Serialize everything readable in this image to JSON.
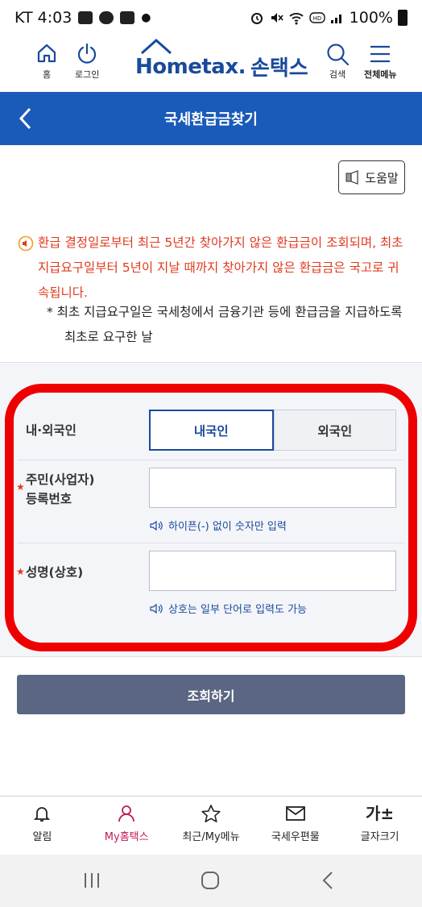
{
  "status_bar": {
    "carrier_time": "KT 4:03",
    "battery": "100%"
  },
  "header": {
    "home_label": "홈",
    "login_label": "로그인",
    "logo_text": "Hometax.",
    "logo_sub": "손택스",
    "search_label": "검색",
    "menu_label": "전체메뉴"
  },
  "titlebar": {
    "title": "국세환급금찾기"
  },
  "help_button": "도움말",
  "notice": "환급 결정일로부터 최근 5년간 찾아가지 않은 환급금이 조회되며, 최초 지급요구일부터 5년이 지날 때까지 찾아가지 않은 환급금은 국고로 귀속됩니다.",
  "note": "* 최초 지급요구일은 국세청에서 금융기관 등에 환급금을 지급하도록 최초로 요구한 날",
  "form": {
    "nationality_label": "내·외국인",
    "domestic": "내국인",
    "foreign": "외국인",
    "id_label_line1": "주민(사업자)",
    "id_label_line2": "등록번호",
    "id_hint": "하이픈(-) 없이 숫자만 입력",
    "name_label": "성명(상호)",
    "name_hint": "상호는 일부 단어로 입력도 가능"
  },
  "submit_button": "조회하기",
  "bottom_nav": [
    {
      "label": "알림",
      "icon": "bell-icon"
    },
    {
      "label": "My홈택스",
      "icon": "person-icon"
    },
    {
      "label": "최근/My메뉴",
      "icon": "star-icon"
    },
    {
      "label": "국세우편물",
      "icon": "mail-icon"
    },
    {
      "label": "글자크기",
      "icon": "font-size-icon",
      "glyph": "가±"
    }
  ],
  "colors": {
    "primary": "#1a5ab8",
    "notice": "#e03a1e",
    "submit": "#5a6682",
    "highlight": "#ee0000",
    "active_nav": "#c2185b"
  }
}
